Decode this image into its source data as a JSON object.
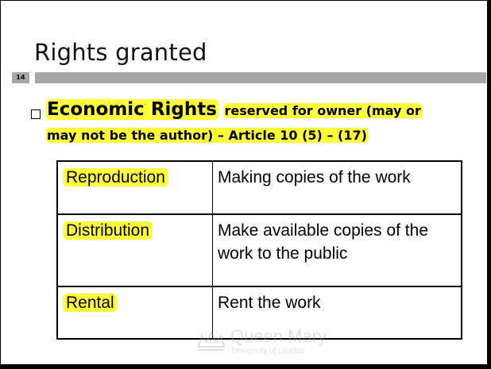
{
  "slide": {
    "title": "Rights granted",
    "page_number": "14",
    "bullet": {
      "lead": "Economic Rights",
      "text_line1": "reserved for owner (may or",
      "text_line2": "may not be the author) – Article 10 (5) – (17)"
    },
    "table": {
      "rows": [
        {
          "right": "Reproduction",
          "description": "Making copies of the work"
        },
        {
          "right": "Distribution",
          "description": "Make available copies of the work to the public"
        },
        {
          "right": "Rental",
          "description": "Rent the work"
        }
      ]
    },
    "watermark": {
      "name": "Queen Mary",
      "subtitle": "University of London"
    },
    "colors": {
      "highlight": "#ffff3a",
      "bar": "#a6a6a6"
    }
  }
}
